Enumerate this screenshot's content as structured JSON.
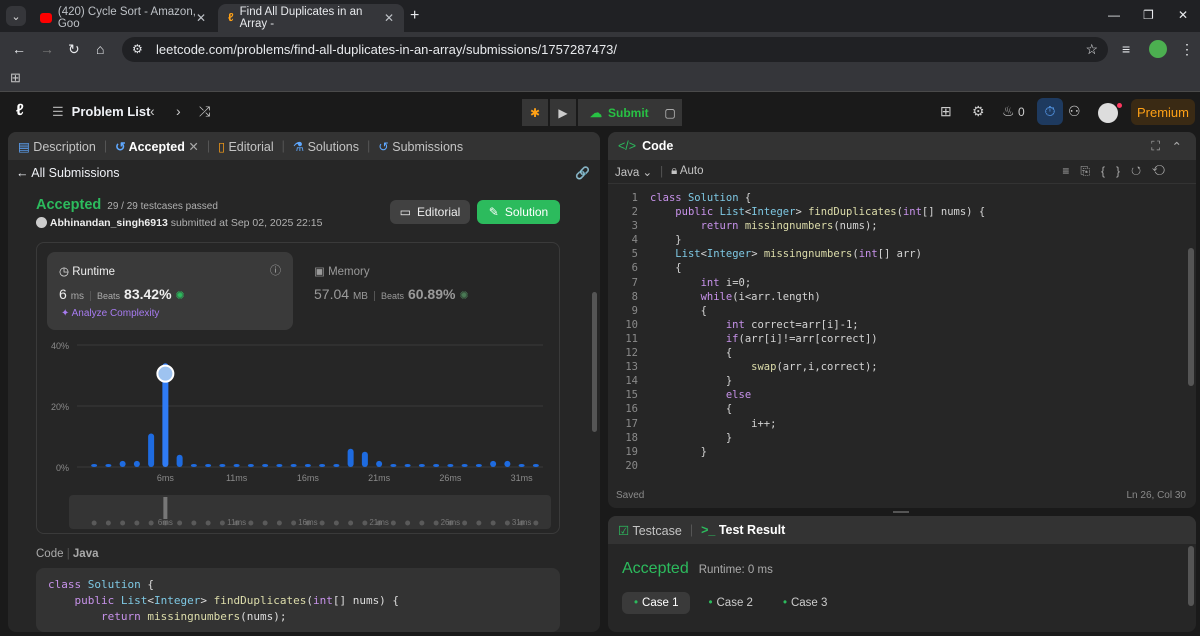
{
  "browser": {
    "tabs": [
      {
        "title": "(420) Cycle Sort - Amazon, Goo"
      },
      {
        "title": "Find All Duplicates in an Array -"
      }
    ],
    "url": "leetcode.com/problems/find-all-duplicates-in-an-array/submissions/1757287473/"
  },
  "topbar": {
    "problem_list": "Problem List",
    "submit": "Submit",
    "fire_count": "0",
    "premium": "Premium"
  },
  "left_tabs": [
    "Description",
    "Accepted",
    "Editorial",
    "Solutions",
    "Submissions"
  ],
  "submission": {
    "back": "All Submissions",
    "status": "Accepted",
    "testcases": "29 / 29 testcases passed",
    "user": "Abhinandan_singh6913",
    "submitted": "submitted at Sep 02, 2025 22:15",
    "editorial_btn": "Editorial",
    "solution_btn": "Solution"
  },
  "runtime": {
    "label": "Runtime",
    "value": "6",
    "unit": "ms",
    "beats_label": "Beats",
    "beats": "83.42%",
    "analyze": "Analyze Complexity"
  },
  "memory": {
    "label": "Memory",
    "value": "57.04",
    "unit": "MB",
    "beats_label": "Beats",
    "beats": "60.89%"
  },
  "chart_data": {
    "type": "bar",
    "y_ticks": [
      "40%",
      "20%",
      "0%"
    ],
    "x_ticks": [
      "6ms",
      "11ms",
      "16ms",
      "21ms",
      "26ms",
      "31ms"
    ],
    "ylim": [
      0,
      40
    ],
    "values": [
      1,
      1,
      2,
      2,
      11,
      34,
      4,
      1,
      1,
      1,
      1,
      1,
      1,
      1,
      1,
      1,
      1,
      1,
      6,
      5,
      2,
      1,
      1,
      1,
      1,
      1,
      1,
      1,
      2,
      2,
      1,
      1
    ],
    "highlight_index": 5
  },
  "code_preview": {
    "label": "Code",
    "lang": "Java"
  },
  "editor": {
    "title": "Code",
    "lang": "Java",
    "mode": "Auto",
    "status": "Saved",
    "cursor": "Ln 26, Col 30"
  },
  "bottom": {
    "tab1": "Testcase",
    "tab2": "Test Result",
    "result": "Accepted",
    "runtime": "Runtime: 0 ms",
    "cases": [
      "Case 1",
      "Case 2",
      "Case 3"
    ]
  }
}
